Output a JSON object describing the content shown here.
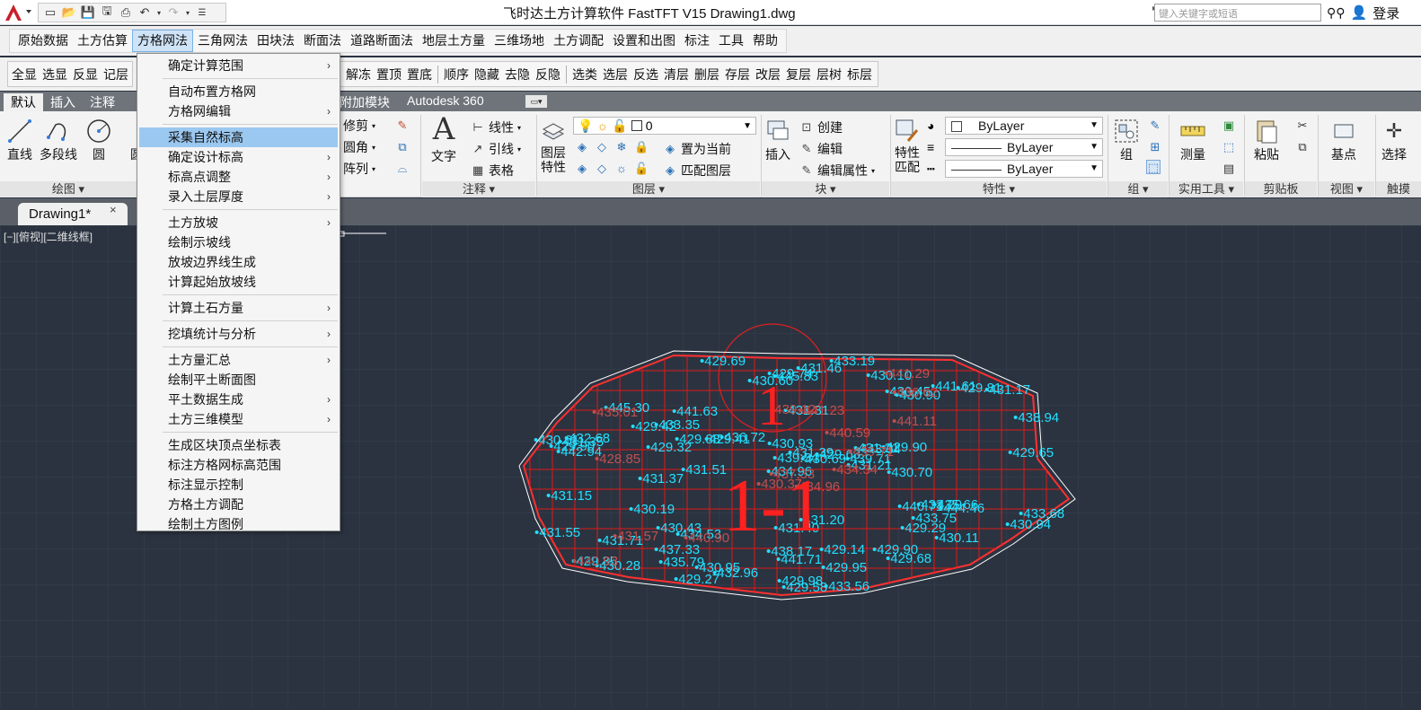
{
  "window": {
    "title": "飞时达土方计算软件 FastTFT V15    Drawing1.dwg",
    "search_placeholder": "键入关键字或短语",
    "login_label": "登录"
  },
  "menubar": {
    "items": [
      "原始数据",
      "土方估算",
      "方格网法",
      "三角网法",
      "田块法",
      "断面法",
      "道路断面法",
      "地层土方量",
      "三维场地",
      "土方调配",
      "设置和出图",
      "标注",
      "工具",
      "帮助"
    ],
    "active_index": 2
  },
  "toolbar2": {
    "left_items": [
      "全显",
      "选显",
      "反显",
      "记层"
    ],
    "right_items": [
      "解冻",
      "置顶",
      "置底",
      "|",
      "顺序",
      "隐藏",
      "去隐",
      "反隐",
      "|",
      "选类",
      "选层",
      "反选",
      "清层",
      "删层",
      "存层",
      "改层",
      "复层",
      "层树",
      "标层"
    ]
  },
  "ribbon_tabs": {
    "items": [
      "默认",
      "插入",
      "注释"
    ],
    "active_index": 0,
    "plugin": "附加模块",
    "a360": "Autodesk 360"
  },
  "ribbon": {
    "draw": {
      "label": "绘图",
      "tools": [
        "直线",
        "多段线",
        "圆",
        "圆"
      ]
    },
    "modify": {
      "tools": [
        "修剪",
        "圆角",
        "阵列"
      ]
    },
    "annotation": {
      "label": "注释",
      "text": "文字",
      "tools": [
        "线性",
        "引线",
        "表格"
      ]
    },
    "layers": {
      "label": "图层",
      "big_tool": "图层特性",
      "current_layer": "0",
      "tools": [
        "置为当前",
        "匹配图层"
      ]
    },
    "block": {
      "label": "块",
      "insert": "插入",
      "tools": [
        "创建",
        "编辑",
        "编辑属性"
      ]
    },
    "properties": {
      "label": "特性",
      "big_tool": "特性匹配",
      "dropdowns": [
        "ByLayer",
        "ByLayer",
        "ByLayer"
      ]
    },
    "group": {
      "label": "组",
      "tool": "组"
    },
    "utilities": {
      "label": "实用工具",
      "tool": "测量"
    },
    "clipboard": {
      "label": "剪贴板",
      "tool": "粘贴"
    },
    "view": {
      "label": "视图",
      "tool": "基点"
    },
    "touch": {
      "label": "触摸",
      "tool": "选择"
    }
  },
  "document": {
    "tab_label": "Drawing1*",
    "close_glyph": "×",
    "viewport_label": "[−][俯视][二维线框]"
  },
  "dropdown": {
    "groups": [
      [
        {
          "label": "确定计算范围",
          "sub": true
        }
      ],
      [
        {
          "label": "自动布置方格网",
          "sub": false
        },
        {
          "label": "方格网编辑",
          "sub": true
        }
      ],
      [
        {
          "label": "采集自然标高",
          "sub": false,
          "highlighted": true
        },
        {
          "label": "确定设计标高",
          "sub": true
        },
        {
          "label": "标高点调整",
          "sub": true
        },
        {
          "label": "录入土层厚度",
          "sub": true
        }
      ],
      [
        {
          "label": "土方放坡",
          "sub": true
        },
        {
          "label": "绘制示坡线",
          "sub": false
        },
        {
          "label": "放坡边界线生成",
          "sub": false
        },
        {
          "label": "计算起始放坡线",
          "sub": false
        }
      ],
      [
        {
          "label": "计算土石方量",
          "sub": true
        }
      ],
      [
        {
          "label": "挖填统计与分析",
          "sub": true
        }
      ],
      [
        {
          "label": "土方量汇总",
          "sub": true
        },
        {
          "label": "绘制平土断面图",
          "sub": false
        },
        {
          "label": "平土数据生成",
          "sub": true
        },
        {
          "label": "土方三维模型",
          "sub": true
        }
      ],
      [
        {
          "label": "生成区块顶点坐标表",
          "sub": false
        },
        {
          "label": "标注方格网标高范围",
          "sub": false
        },
        {
          "label": "标注显示控制",
          "sub": false
        },
        {
          "label": "方格土方调配",
          "sub": false
        },
        {
          "label": "绘制土方图例",
          "sub": false
        }
      ]
    ]
  },
  "drawing": {
    "section_label": "1-1",
    "section_label_small": "1",
    "cyan_labels": [
      "436.72",
      "435.79",
      "431.31",
      "443.34",
      "444.46",
      "445.30",
      "445.83",
      "442.94",
      "440.71",
      "434.96",
      "438.17",
      "439.54",
      "441.63",
      "441.61",
      "434.53",
      "435.66",
      "433.19",
      "429.41",
      "429.32",
      "429.29",
      "429.27",
      "430.61",
      "439.71",
      "441.71",
      "431.21",
      "431.71",
      "438.94",
      "433.75",
      "429.68",
      "437.33",
      "429.14",
      "431.17",
      "431.46",
      "431.51",
      "432.68",
      "433.35",
      "429.81",
      "430.10",
      "430.60",
      "431.39",
      "431.55",
      "431.40",
      "432.96",
      "433.29",
      "429.88",
      "429.35",
      "429.42",
      "431.15",
      "430.93",
      "429.95",
      "429.63",
      "430.28",
      "430.70",
      "433.68",
      "429.98",
      "429.65",
      "431.20",
      "433.56",
      "429.90",
      "429.74",
      "429.90",
      "430.11",
      "430.69",
      "430.94",
      "431.35",
      "429.58",
      "430.45",
      "430.90",
      "431.37",
      "429.69",
      "429.90",
      "430.19",
      "430.43",
      "430.95",
      "431.21"
    ],
    "red_labels": [
      "434.96",
      "435.01",
      "437.33",
      "440.93",
      "439.71",
      "440.90",
      "441.29",
      "441.23",
      "436.62",
      "434.34",
      "428.85",
      "430.37",
      "441.11",
      "439.12",
      "440.59",
      "431.57"
    ]
  }
}
